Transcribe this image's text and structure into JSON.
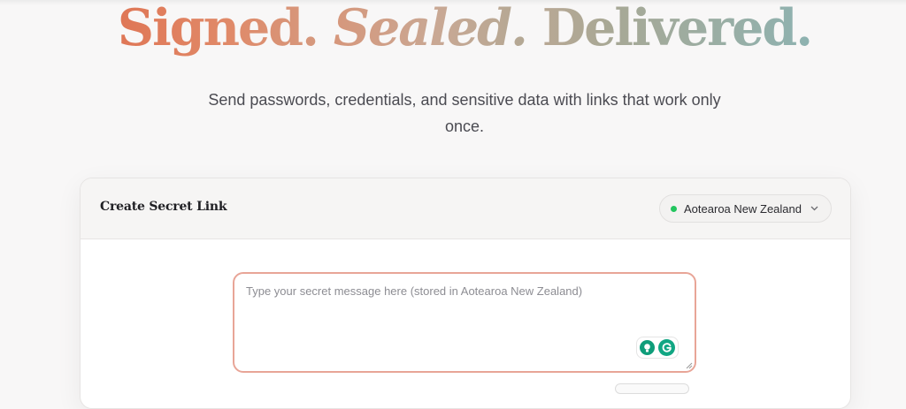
{
  "hero": {
    "word1": "Signed.",
    "word2": "Sealed.",
    "word3": "Delivered."
  },
  "subtitle": "Send passwords, credentials, and sensitive data with links that work only once.",
  "card": {
    "title": "Create Secret Link",
    "region": {
      "selected": "Aotearoa New Zealand",
      "status_color": "#22c55e"
    },
    "message": {
      "value": "",
      "placeholder": "Type your secret message here (stored in Aotearoa New Zealand)"
    }
  },
  "colors": {
    "accent_start": "#de5a3a",
    "accent_end": "#7fb8c0",
    "textarea_border": "#e8a597",
    "grammarly_green": "#11a683"
  },
  "icons": {
    "region_chevron": "chevron-down-icon",
    "grammarly_bulb": "lightbulb-icon",
    "grammarly_logo": "grammarly-icon"
  }
}
